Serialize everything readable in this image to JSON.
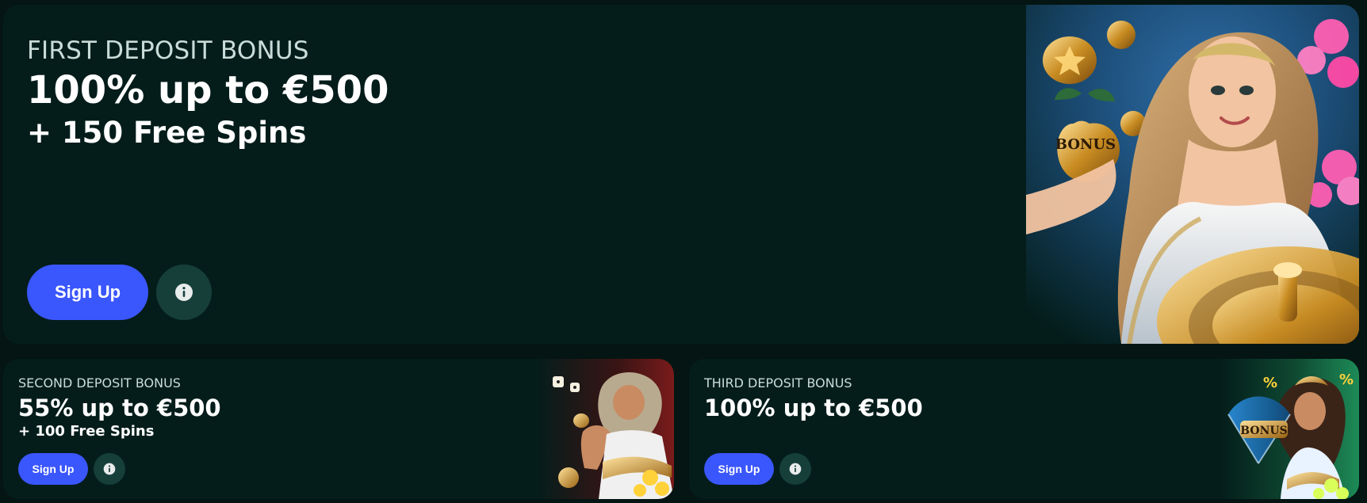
{
  "bonuses": {
    "first": {
      "eyebrow": "FIRST DEPOSIT BONUS",
      "headline": "100% up to €500",
      "sub": "+ 150 Free Spins",
      "signup_label": "Sign Up",
      "art_text": "BONUS"
    },
    "second": {
      "eyebrow": "SECOND DEPOSIT BONUS",
      "headline": "55% up to €500",
      "sub": "+ 100 Free Spins",
      "signup_label": "Sign Up"
    },
    "third": {
      "eyebrow": "THIRD DEPOSIT BONUS",
      "headline": "100% up to €500",
      "signup_label": "Sign Up",
      "art_text": "BONUS",
      "badge_text": "%"
    }
  },
  "colors": {
    "background": "#041513",
    "card": "#041d1b",
    "primary_button": "#3a56fd",
    "info_button": "#163f3a",
    "muted_text": "#c9dcd8",
    "text": "#ffffff"
  }
}
